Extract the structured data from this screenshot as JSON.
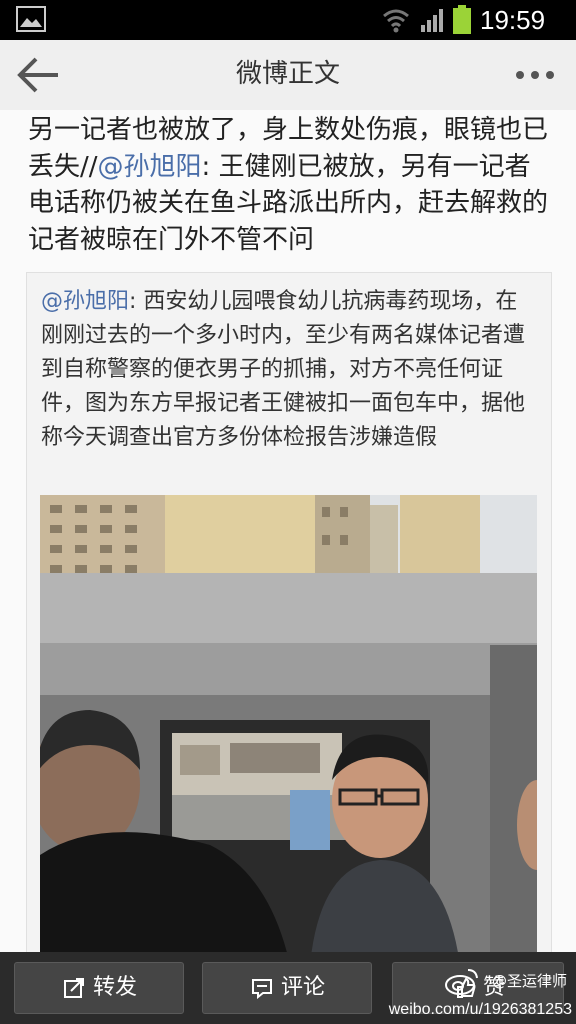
{
  "status_bar": {
    "time": "19:59",
    "icons": [
      "gallery-icon",
      "wifi-icon",
      "signal-icon",
      "battery-icon"
    ],
    "battery_color": "#9bd337"
  },
  "header": {
    "title": "微博正文",
    "back_icon": "back-arrow-icon",
    "more_icon": "more-dots-icon"
  },
  "post": {
    "text_a": "另一记者也被放了，身上数处伤痕，眼镜也已丢失//",
    "mention": "@孙旭阳",
    "text_b": ": 王健刚已被放，另有一记者电话称仍被关在鱼斗路派出所内，赶去解救的记者被晾在门外不管不问"
  },
  "repost": {
    "author": "@孙旭阳",
    "text": ": 西安幼儿园喂食幼儿抗病毒药现场，在刚刚过去的一个多小时内，至少有两名媒体记者遭到自称警察的便衣男子的抓捕，对方不亮任何证件，图为东方早报记者王健被扣一面包车中，据他称今天调查出官方多份体检报告涉嫌造假"
  },
  "actions": [
    {
      "label": "转发",
      "icon": "share-icon"
    },
    {
      "label": "评论",
      "icon": "comment-icon"
    },
    {
      "label": "赞",
      "icon": "like-icon"
    }
  ],
  "watermark": {
    "handle": "@圣运律师",
    "url": "weibo.com/u/1926381253"
  },
  "colors": {
    "mention": "#4a6ea9",
    "toolbar": "#2b2b2b",
    "button": "#454545"
  }
}
